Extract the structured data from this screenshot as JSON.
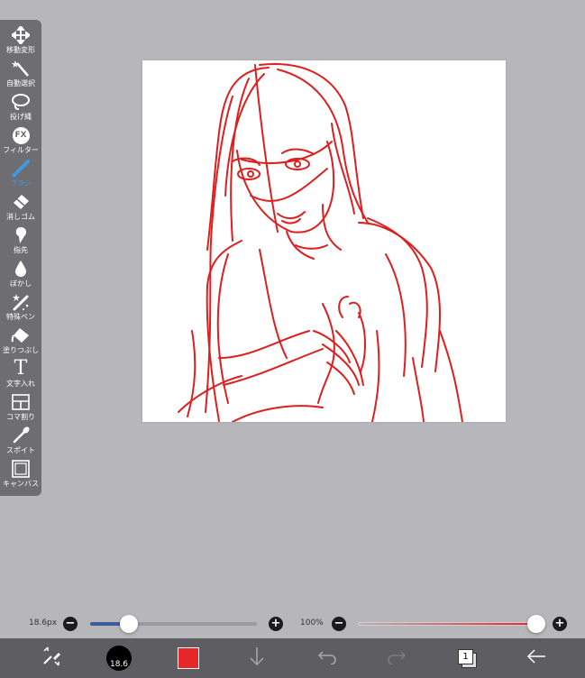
{
  "toolbar": {
    "items": [
      {
        "label": "移動変形",
        "icon": "move-transform-icon"
      },
      {
        "label": "自動選択",
        "icon": "magic-wand-icon"
      },
      {
        "label": "投げ縄",
        "icon": "lasso-icon"
      },
      {
        "label": "フィルター",
        "icon": "fx-filter-icon",
        "glyph": "FX"
      },
      {
        "label": "ブラシ",
        "icon": "brush-icon",
        "active": true
      },
      {
        "label": "消しゴム",
        "icon": "eraser-icon"
      },
      {
        "label": "指先",
        "icon": "finger-smudge-icon"
      },
      {
        "label": "ぼかし",
        "icon": "blur-drop-icon"
      },
      {
        "label": "特殊ペン",
        "icon": "special-pen-icon"
      },
      {
        "label": "塗りつぶし",
        "icon": "fill-bucket-icon"
      },
      {
        "label": "文字入れ",
        "icon": "text-tool-icon",
        "glyph": "T"
      },
      {
        "label": "コマ割り",
        "icon": "frame-divider-icon"
      },
      {
        "label": "スポイト",
        "icon": "eyedropper-icon"
      },
      {
        "label": "キャンバス",
        "icon": "canvas-icon"
      }
    ]
  },
  "brush_size": {
    "label": "18.6px",
    "minus": "−",
    "plus": "+",
    "level": 0.23
  },
  "opacity": {
    "label": "100%",
    "minus": "−",
    "plus": "+",
    "level": 1.0
  },
  "bottom_bar": {
    "brush_size_badge": "18.6",
    "color_hex": "#e8272a",
    "layer_count": "1"
  },
  "colors": {
    "accent": "#3c9ae8",
    "stroke": "#dd1f1f"
  }
}
